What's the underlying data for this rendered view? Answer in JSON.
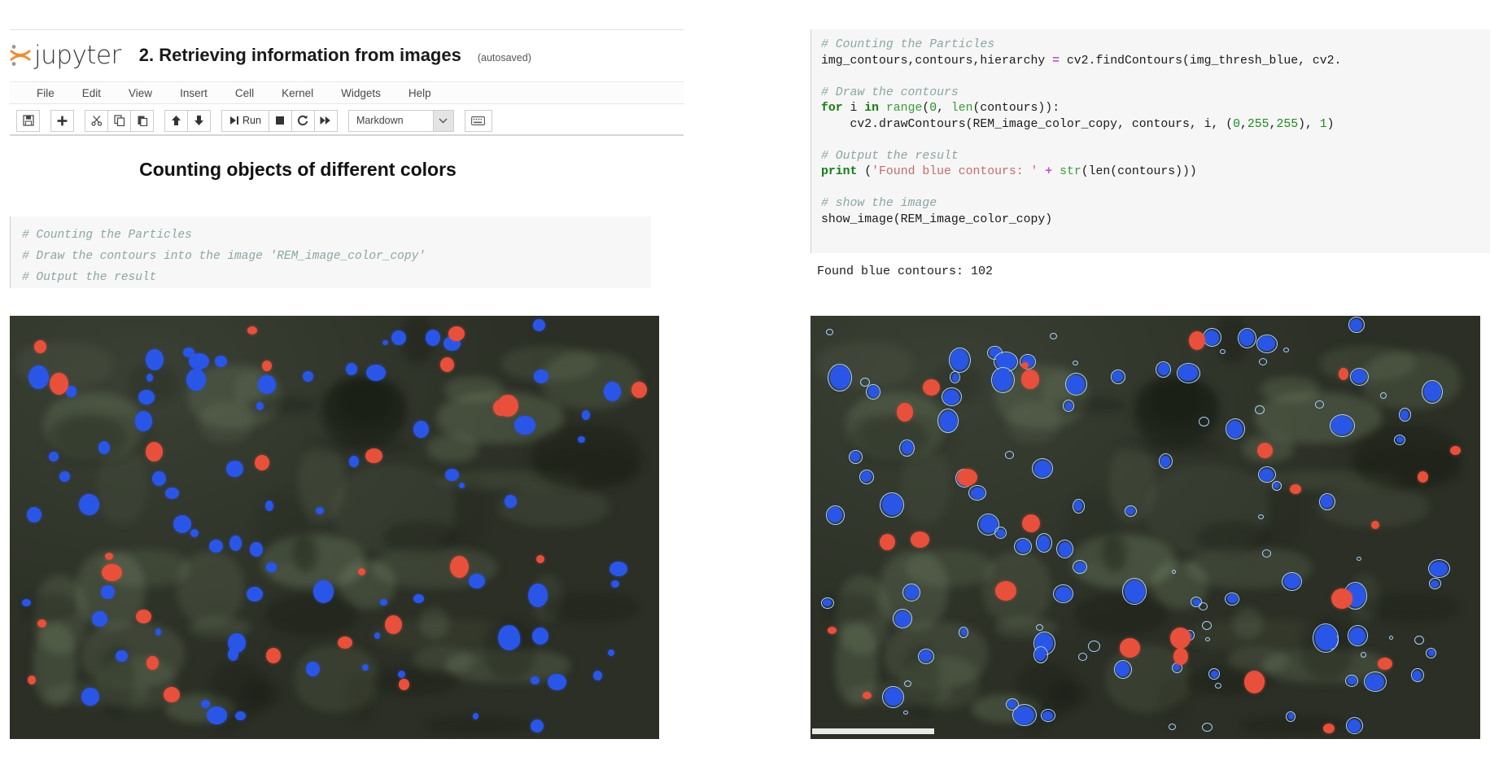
{
  "notebook": {
    "logo_text": "jupyter",
    "title": "2. Retrieving information from images",
    "autosave_status": "(autosaved)",
    "menu": [
      {
        "label": "File"
      },
      {
        "label": "Edit"
      },
      {
        "label": "View"
      },
      {
        "label": "Insert"
      },
      {
        "label": "Cell"
      },
      {
        "label": "Kernel"
      },
      {
        "label": "Widgets"
      },
      {
        "label": "Help"
      }
    ],
    "toolbar": {
      "save_icon": "💾",
      "add_icon": "✚",
      "cut_icon": "✂",
      "copy_icon": "⧉",
      "paste_icon": "📋",
      "move_up_icon": "⬆",
      "move_down_icon": "⬇",
      "run_icon": "▶❙",
      "run_label": "Run",
      "stop_icon": "■",
      "restart_icon": "↻",
      "fastforward_icon": "⏩",
      "cell_type_value": "Markdown",
      "dropdown_arrow": "⌵",
      "command_palette_icon": "⌨"
    },
    "markdown_heading": "Counting objects of different colors",
    "left_cell_lines": [
      "# Counting the Particles",
      "",
      "# Draw the contours into the image 'REM_image_color_copy'",
      "",
      "# Output the result"
    ]
  },
  "right_cell": {
    "lines": [
      {
        "type": "comment",
        "text": "# Counting the Particles"
      },
      {
        "type": "code",
        "text": "img_contours,contours,hierarchy = cv2.findContours(img_thresh_blue, cv2."
      },
      {
        "type": "blank",
        "text": ""
      },
      {
        "type": "comment",
        "text": "# Draw the contours"
      },
      {
        "type": "code",
        "text": "for i in range(0, len(contours)):"
      },
      {
        "type": "code",
        "text": "    cv2.drawContours(REM_image_color_copy, contours, i, (0,255,255), 1)"
      },
      {
        "type": "blank",
        "text": ""
      },
      {
        "type": "comment",
        "text": "# Output the result"
      },
      {
        "type": "code",
        "text": "print ('Found blue contours: ' + str(len(contours)))"
      },
      {
        "type": "blank",
        "text": ""
      },
      {
        "type": "comment",
        "text": "# show the image"
      },
      {
        "type": "code",
        "text": "show_image(REM_image_color_copy)"
      }
    ],
    "tokens": {
      "l1_comment": "# Counting the Particles",
      "l2_a": "img_contours,contours,hierarchy ",
      "l2_eq": "=",
      "l2_b": " cv2.findContours(img_thresh_blue, cv2.",
      "l4_comment": "# Draw the contours",
      "l5_for": "for",
      "l5_i": " i ",
      "l5_in": "in",
      "l5_range": " range",
      "l5_p1": "(",
      "l5_zero": "0",
      "l5_c": ", ",
      "l5_len": "len",
      "l5_rest": "(contours)):",
      "l6_text": "    cv2.drawContours(REM_image_color_copy, contours, i, (",
      "l6_0": "0",
      "l6_c1": ",",
      "l6_255a": "255",
      "l6_c2": ",",
      "l6_255b": "255",
      "l6_close": "), ",
      "l6_1": "1",
      "l6_end": ")",
      "l8_comment": "# Output the result",
      "l9_print": "print",
      "l9_open": " (",
      "l9_str": "'Found blue contours: '",
      "l9_plus": "+",
      "l9_strfn": " str",
      "l9_tail": "(len(contours)))",
      "l11_comment": "# show the image",
      "l12_text": "show_image(REM_image_color_copy)"
    },
    "output_text": "Found blue contours: 102"
  },
  "images": {
    "left": {
      "alt": "REM microscopy image with red and blue particles",
      "background_color": "#2f3328"
    },
    "right": {
      "alt": "REM microscopy image with cyan contours drawn around blue particles",
      "background_color": "#2f3328",
      "contour_color": "#9fd0ff"
    }
  },
  "colors": {
    "blue_particle": "#2a56e8",
    "red_particle": "#e8503c",
    "contour": "#a8d2ff",
    "cell_bg": "#f6f6f6",
    "comment": "#8aa6a3",
    "keyword": "#147d14",
    "string": "#c86a6a",
    "operator": "#c850c8"
  }
}
